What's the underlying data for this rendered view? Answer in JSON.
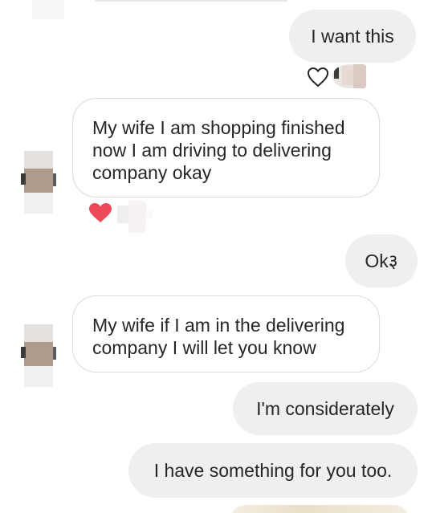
{
  "conversation": {
    "messages": [
      {
        "direction": "outgoing",
        "text": "I want this"
      },
      {
        "direction": "incoming",
        "lines": [
          "My wife I am shopping finished",
          "now I am driving to delivering",
          "company okay"
        ]
      },
      {
        "direction": "outgoing",
        "text": "Ok३"
      },
      {
        "direction": "incoming",
        "lines": [
          "My wife if I am in the delivering",
          "company I will let you know"
        ]
      },
      {
        "direction": "outgoing",
        "text": "I'm considerately"
      },
      {
        "direction": "outgoing",
        "text": "I have something for you too."
      }
    ]
  },
  "reactions": {
    "message_1": {
      "icon": "heart-outline-icon",
      "liked": false
    },
    "message_2": {
      "icon": "heart-filled-icon",
      "liked": true,
      "color": "#ed4956"
    }
  },
  "colors": {
    "outgoing_bubble": "#efefef",
    "incoming_border": "#dbdbdb",
    "text": "#262626",
    "heart_red": "#ed4956"
  }
}
